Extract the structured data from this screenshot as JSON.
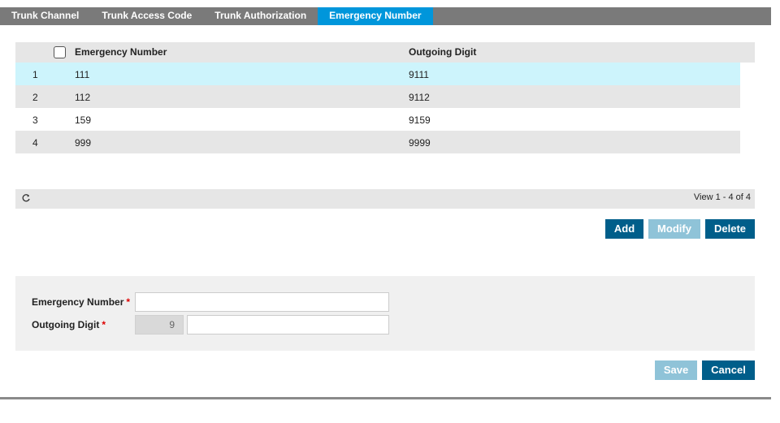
{
  "tabs": [
    {
      "label": "Trunk Channel"
    },
    {
      "label": "Trunk Access Code"
    },
    {
      "label": "Trunk Authorization"
    },
    {
      "label": "Emergency Number"
    }
  ],
  "grid": {
    "columns": [
      "Emergency Number",
      "Outgoing Digit"
    ],
    "rows": [
      {
        "index": "1",
        "number": "111",
        "digit": "9111"
      },
      {
        "index": "2",
        "number": "112",
        "digit": "9112"
      },
      {
        "index": "3",
        "number": "159",
        "digit": "9159"
      },
      {
        "index": "4",
        "number": "999",
        "digit": "9999"
      }
    ],
    "pager_info": "View 1 - 4 of 4"
  },
  "actions": {
    "add": "Add",
    "modify": "Modify",
    "delete": "Delete"
  },
  "form": {
    "emergency_label": "Emergency Number",
    "outgoing_label": "Outgoing Digit",
    "required_mark": "*",
    "emergency_value": "",
    "outgoing_prefix": "9",
    "outgoing_value": ""
  },
  "footer": {
    "save": "Save",
    "cancel": "Cancel"
  },
  "colors": {
    "active_tab": "#0096db",
    "primary_button": "#005e8a",
    "disabled_button": "#8fc3d8",
    "selected_row": "#cdf4fc"
  }
}
